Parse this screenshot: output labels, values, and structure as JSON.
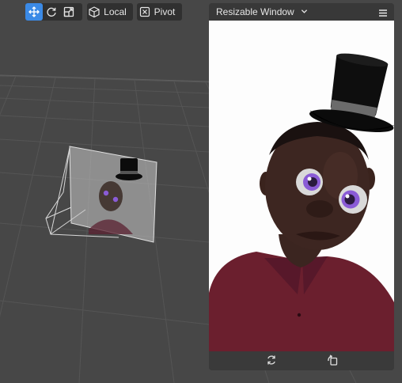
{
  "toolbar": {
    "move_tool": {
      "icon": "move-icon",
      "active": true
    },
    "rotate_tool": {
      "icon": "rotate-icon"
    },
    "scale_tool": {
      "icon": "scale-icon"
    },
    "space_toggle": {
      "label": "Local",
      "icon": "cube-icon"
    },
    "pivot_toggle": {
      "label": "Pivot",
      "icon": "pivot-icon"
    }
  },
  "preview_window": {
    "title": "Resizable Window",
    "chevron_icon": "chevron-down-icon",
    "menu_icon": "hamburger-menu-icon",
    "footer": {
      "refresh_icon": "refresh-icon",
      "rotate_device_icon": "rotate-device-icon"
    }
  },
  "colors": {
    "accent": "#3b8ae6",
    "viewport_bg": "#474747",
    "panel_bg": "#383838",
    "eye_iris": "#8a5bd6",
    "shirt": "#6b1f2e"
  }
}
